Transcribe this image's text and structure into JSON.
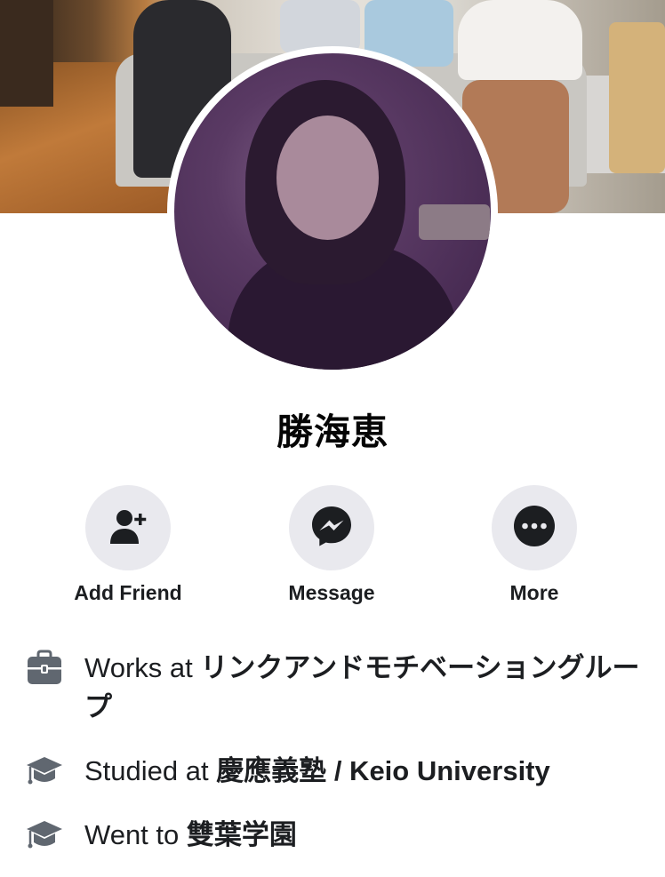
{
  "profile": {
    "name": "勝海恵"
  },
  "actions": [
    {
      "label": "Add Friend",
      "icon": "add-friend-icon"
    },
    {
      "label": "Message",
      "icon": "messenger-icon"
    },
    {
      "label": "More",
      "icon": "more-icon"
    }
  ],
  "info": {
    "work": {
      "prefix": "Works at ",
      "value": "リンクアンドモチベーショングループ",
      "icon": "briefcase-icon"
    },
    "college": {
      "prefix": "Studied at ",
      "value": "慶應義塾 / Keio University",
      "icon": "graduation-cap-icon"
    },
    "school": {
      "prefix": "Went to ",
      "value": "雙葉学園",
      "icon": "graduation-cap-icon"
    }
  },
  "colors": {
    "icon_fill": "#1c1e21",
    "button_bg": "#e9e9ee",
    "info_icon": "#606770"
  }
}
